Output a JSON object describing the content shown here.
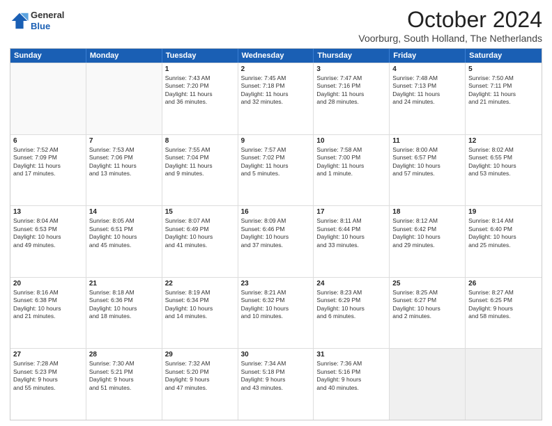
{
  "header": {
    "logo_general": "General",
    "logo_blue": "Blue",
    "title": "October 2024",
    "subtitle": "Voorburg, South Holland, The Netherlands"
  },
  "days": [
    "Sunday",
    "Monday",
    "Tuesday",
    "Wednesday",
    "Thursday",
    "Friday",
    "Saturday"
  ],
  "rows": [
    [
      {
        "day": "",
        "lines": [],
        "empty": true
      },
      {
        "day": "",
        "lines": [],
        "empty": true
      },
      {
        "day": "1",
        "lines": [
          "Sunrise: 7:43 AM",
          "Sunset: 7:20 PM",
          "Daylight: 11 hours",
          "and 36 minutes."
        ]
      },
      {
        "day": "2",
        "lines": [
          "Sunrise: 7:45 AM",
          "Sunset: 7:18 PM",
          "Daylight: 11 hours",
          "and 32 minutes."
        ]
      },
      {
        "day": "3",
        "lines": [
          "Sunrise: 7:47 AM",
          "Sunset: 7:16 PM",
          "Daylight: 11 hours",
          "and 28 minutes."
        ]
      },
      {
        "day": "4",
        "lines": [
          "Sunrise: 7:48 AM",
          "Sunset: 7:13 PM",
          "Daylight: 11 hours",
          "and 24 minutes."
        ]
      },
      {
        "day": "5",
        "lines": [
          "Sunrise: 7:50 AM",
          "Sunset: 7:11 PM",
          "Daylight: 11 hours",
          "and 21 minutes."
        ]
      }
    ],
    [
      {
        "day": "6",
        "lines": [
          "Sunrise: 7:52 AM",
          "Sunset: 7:09 PM",
          "Daylight: 11 hours",
          "and 17 minutes."
        ]
      },
      {
        "day": "7",
        "lines": [
          "Sunrise: 7:53 AM",
          "Sunset: 7:06 PM",
          "Daylight: 11 hours",
          "and 13 minutes."
        ]
      },
      {
        "day": "8",
        "lines": [
          "Sunrise: 7:55 AM",
          "Sunset: 7:04 PM",
          "Daylight: 11 hours",
          "and 9 minutes."
        ]
      },
      {
        "day": "9",
        "lines": [
          "Sunrise: 7:57 AM",
          "Sunset: 7:02 PM",
          "Daylight: 11 hours",
          "and 5 minutes."
        ]
      },
      {
        "day": "10",
        "lines": [
          "Sunrise: 7:58 AM",
          "Sunset: 7:00 PM",
          "Daylight: 11 hours",
          "and 1 minute."
        ]
      },
      {
        "day": "11",
        "lines": [
          "Sunrise: 8:00 AM",
          "Sunset: 6:57 PM",
          "Daylight: 10 hours",
          "and 57 minutes."
        ]
      },
      {
        "day": "12",
        "lines": [
          "Sunrise: 8:02 AM",
          "Sunset: 6:55 PM",
          "Daylight: 10 hours",
          "and 53 minutes."
        ]
      }
    ],
    [
      {
        "day": "13",
        "lines": [
          "Sunrise: 8:04 AM",
          "Sunset: 6:53 PM",
          "Daylight: 10 hours",
          "and 49 minutes."
        ]
      },
      {
        "day": "14",
        "lines": [
          "Sunrise: 8:05 AM",
          "Sunset: 6:51 PM",
          "Daylight: 10 hours",
          "and 45 minutes."
        ]
      },
      {
        "day": "15",
        "lines": [
          "Sunrise: 8:07 AM",
          "Sunset: 6:49 PM",
          "Daylight: 10 hours",
          "and 41 minutes."
        ]
      },
      {
        "day": "16",
        "lines": [
          "Sunrise: 8:09 AM",
          "Sunset: 6:46 PM",
          "Daylight: 10 hours",
          "and 37 minutes."
        ]
      },
      {
        "day": "17",
        "lines": [
          "Sunrise: 8:11 AM",
          "Sunset: 6:44 PM",
          "Daylight: 10 hours",
          "and 33 minutes."
        ]
      },
      {
        "day": "18",
        "lines": [
          "Sunrise: 8:12 AM",
          "Sunset: 6:42 PM",
          "Daylight: 10 hours",
          "and 29 minutes."
        ]
      },
      {
        "day": "19",
        "lines": [
          "Sunrise: 8:14 AM",
          "Sunset: 6:40 PM",
          "Daylight: 10 hours",
          "and 25 minutes."
        ]
      }
    ],
    [
      {
        "day": "20",
        "lines": [
          "Sunrise: 8:16 AM",
          "Sunset: 6:38 PM",
          "Daylight: 10 hours",
          "and 21 minutes."
        ]
      },
      {
        "day": "21",
        "lines": [
          "Sunrise: 8:18 AM",
          "Sunset: 6:36 PM",
          "Daylight: 10 hours",
          "and 18 minutes."
        ]
      },
      {
        "day": "22",
        "lines": [
          "Sunrise: 8:19 AM",
          "Sunset: 6:34 PM",
          "Daylight: 10 hours",
          "and 14 minutes."
        ]
      },
      {
        "day": "23",
        "lines": [
          "Sunrise: 8:21 AM",
          "Sunset: 6:32 PM",
          "Daylight: 10 hours",
          "and 10 minutes."
        ]
      },
      {
        "day": "24",
        "lines": [
          "Sunrise: 8:23 AM",
          "Sunset: 6:29 PM",
          "Daylight: 10 hours",
          "and 6 minutes."
        ]
      },
      {
        "day": "25",
        "lines": [
          "Sunrise: 8:25 AM",
          "Sunset: 6:27 PM",
          "Daylight: 10 hours",
          "and 2 minutes."
        ]
      },
      {
        "day": "26",
        "lines": [
          "Sunrise: 8:27 AM",
          "Sunset: 6:25 PM",
          "Daylight: 9 hours",
          "and 58 minutes."
        ]
      }
    ],
    [
      {
        "day": "27",
        "lines": [
          "Sunrise: 7:28 AM",
          "Sunset: 5:23 PM",
          "Daylight: 9 hours",
          "and 55 minutes."
        ]
      },
      {
        "day": "28",
        "lines": [
          "Sunrise: 7:30 AM",
          "Sunset: 5:21 PM",
          "Daylight: 9 hours",
          "and 51 minutes."
        ]
      },
      {
        "day": "29",
        "lines": [
          "Sunrise: 7:32 AM",
          "Sunset: 5:20 PM",
          "Daylight: 9 hours",
          "and 47 minutes."
        ]
      },
      {
        "day": "30",
        "lines": [
          "Sunrise: 7:34 AM",
          "Sunset: 5:18 PM",
          "Daylight: 9 hours",
          "and 43 minutes."
        ]
      },
      {
        "day": "31",
        "lines": [
          "Sunrise: 7:36 AM",
          "Sunset: 5:16 PM",
          "Daylight: 9 hours",
          "and 40 minutes."
        ]
      },
      {
        "day": "",
        "lines": [],
        "empty": true,
        "shaded": true
      },
      {
        "day": "",
        "lines": [],
        "empty": true,
        "shaded": true
      }
    ]
  ]
}
